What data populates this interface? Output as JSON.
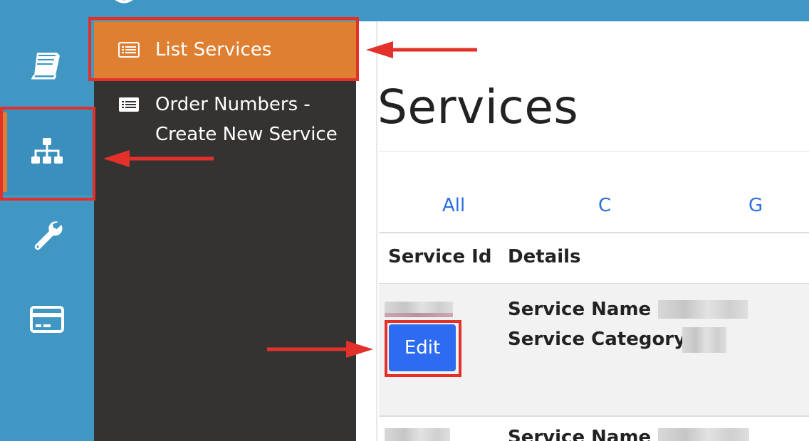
{
  "submenu": {
    "items": [
      {
        "label": "List Services",
        "icon": "list-icon",
        "active": true
      },
      {
        "label": "Order Numbers - Create New Service",
        "icon": "list-icon",
        "active": false
      }
    ]
  },
  "rail": {
    "items": [
      {
        "icon": "book-icon"
      },
      {
        "icon": "sitemap-icon",
        "active": true
      },
      {
        "icon": "wrench-icon"
      },
      {
        "icon": "credit-card-icon"
      }
    ]
  },
  "page": {
    "title": "Services",
    "filters": [
      "All",
      "C",
      "G"
    ],
    "columns": {
      "id": "Service Id",
      "details": "Details"
    },
    "row1": {
      "name_label": "Service Name :",
      "category_label": "Service Category:",
      "edit_label": "Edit"
    },
    "row2": {
      "name_label": "Service Name :"
    }
  },
  "colors": {
    "brand_blue": "#4197c4",
    "accent_orange": "#de7f32",
    "panel_dark": "#343332",
    "link_blue": "#2b6fe0",
    "button_blue": "#2d6cf0",
    "annotation_red": "#e3312a"
  }
}
